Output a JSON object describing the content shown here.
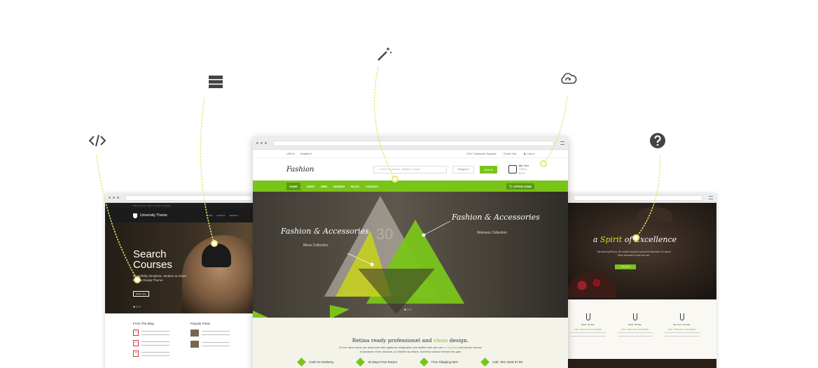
{
  "icons": [
    "code-icon",
    "layers-icon",
    "magic-wand-icon",
    "cloud-sync-icon",
    "help-icon"
  ],
  "colors": {
    "accent": "#7ac41a",
    "dotted_line": "#e8e870"
  },
  "left_site": {
    "breadcrumb": "Blog / Events / Labs / Courses / Contact",
    "brand": "University Theme",
    "nav": [
      "HOME",
      "EVENTS",
      "SEARCH"
    ],
    "hero_title": "Search Courses",
    "hero_text": "Beautifully Simplistic, Modern & Clean Retina Ready Theme",
    "hero_button": "Read more",
    "blog_heading": "From The Blog",
    "popular_heading": "Popular Posts",
    "dates": [
      "04",
      "21",
      "16"
    ]
  },
  "center_site": {
    "currency": "USD ▾",
    "language": "English ▾",
    "support": "24x7 Customer Support",
    "checkout": "Check Out",
    "login": "Log in",
    "logo": "Fashion",
    "search_placeholder": "Search for product, category or brand",
    "category": "Category ▾",
    "search_button": "Search",
    "cart_title": "My Cart",
    "cart_sub": "0 items - $0.00",
    "nav": [
      "HOME",
      "SHOP",
      "MEN",
      "WOMEN",
      "BLOG",
      "CONTACT"
    ],
    "offer": "OFFER ZONE",
    "hero_left_title": "Fashion & Accessories",
    "hero_left_sub": "Mens Collection",
    "hero_right_title": "Fashion & Accessories",
    "hero_right_sub": "Womens Collection",
    "hero_number": "30",
    "tagline_start": "Retina ready professionel and",
    "tagline_accent": "clean",
    "tagline_end": "design.",
    "desc_line1_start": "On the other hand, we denounce with righteous indignation and dislike men who are",
    "desc_line1_accent": "so beguiled",
    "desc_line1_end": "and by the charms",
    "desc_line2": "of pleasure of the moment, so blinded by desire, that they cannot foresee the pain",
    "features": [
      "Cash On Delivery",
      "30 Days Free Return",
      "Free Shipping Item",
      "Call : 001 2345 67 89"
    ]
  },
  "right_site": {
    "hero_title_start": "a",
    "hero_title_accent": "Spirit",
    "hero_title_end": "of Excellence",
    "hero_text": "Introducing Rivera, the world's superior premium wineries. It's about Wine because of who we are.",
    "hero_button": "Read more",
    "items": [
      {
        "name": "RED WINE",
        "sub": "Our Famous Cocktails"
      },
      {
        "name": "RED WINE",
        "sub": "Our Famous Cocktails"
      },
      {
        "name": "BLACK WINE",
        "sub": "Our Famous Cocktails"
      }
    ]
  }
}
